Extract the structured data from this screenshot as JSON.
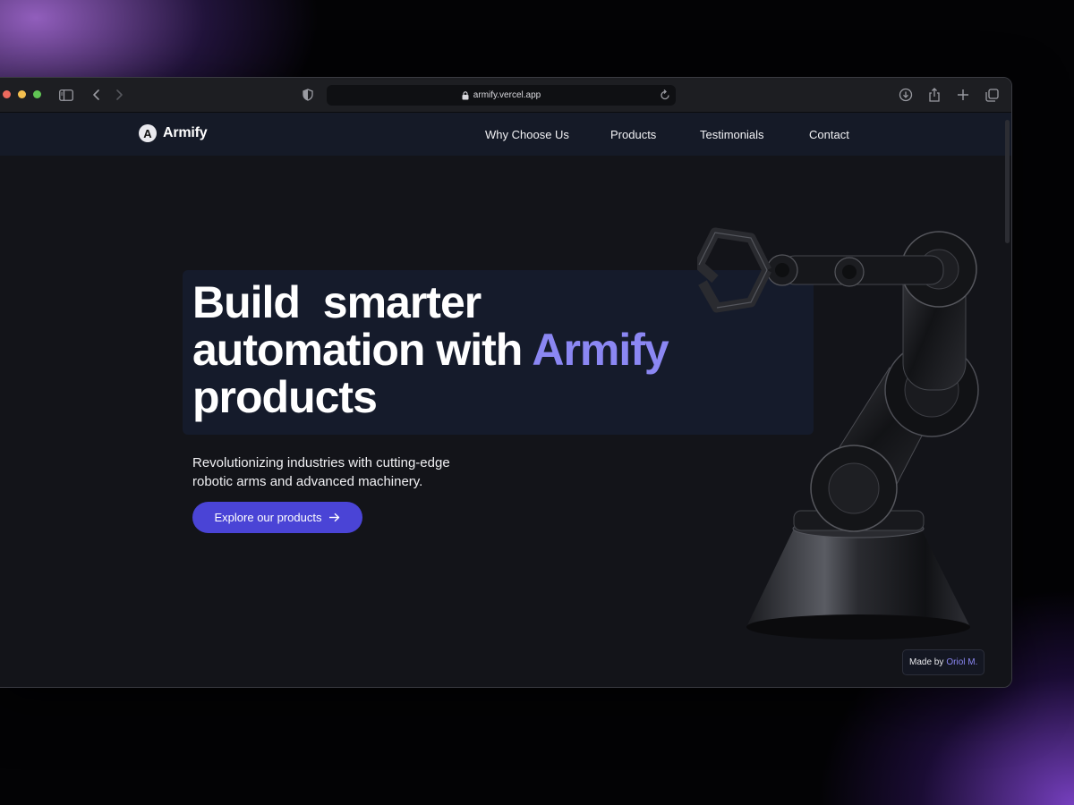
{
  "browser": {
    "url": "armify.vercel.app"
  },
  "site": {
    "logo_letter": "A",
    "brand": "Armify",
    "nav": [
      {
        "label": "Why Choose Us"
      },
      {
        "label": "Products"
      },
      {
        "label": "Testimonials"
      },
      {
        "label": "Contact"
      }
    ]
  },
  "hero": {
    "headline_line1": "Build  smarter",
    "headline_line2_prefix": "automation with ",
    "headline_accent": "Armify",
    "headline_line3": "products",
    "subtitle_line1": "Revolutionizing industries with cutting-edge",
    "subtitle_line2": "robotic arms and advanced machinery.",
    "cta_label": "Explore our products"
  },
  "credit": {
    "prefix": "Made by",
    "author": "Oriol M."
  },
  "colors": {
    "accent": "#8b87f3",
    "button": "#4a44d6",
    "navbar": "#151a27",
    "page_bg": "#131419"
  },
  "icons": {
    "sidebar": "sidebar-icon",
    "back": "chevron-left-icon",
    "forward": "chevron-right-icon",
    "shield": "shield-icon",
    "lock": "lock-icon",
    "reload": "reload-icon",
    "download": "download-icon",
    "share": "share-icon",
    "new_tab": "plus-icon",
    "tabs": "tabs-overview-icon",
    "cta_arrow": "arrow-right-icon"
  }
}
